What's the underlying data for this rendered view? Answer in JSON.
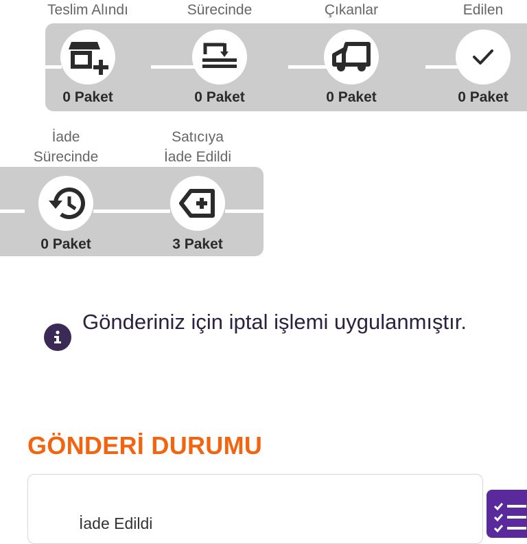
{
  "stages_row1": [
    {
      "label": "Teslim Alındı",
      "count": "0 Paket",
      "icon": "store-add-icon"
    },
    {
      "label": "Sürecinde",
      "count": "0 Paket",
      "icon": "transfer-icon"
    },
    {
      "label": "Çıkanlar",
      "count": "0 Paket",
      "icon": "truck-icon"
    },
    {
      "label": "Edilen",
      "count": "0 Paket",
      "icon": "check-icon"
    }
  ],
  "stages_row2": [
    {
      "label_line1": "İade",
      "label_line2": "Sürecinde",
      "count": "0 Paket",
      "icon": "history-icon"
    },
    {
      "label_line1": "Satıcıya",
      "label_line2": "İade Edildi",
      "count": "3 Paket",
      "icon": "return-tag-icon"
    }
  ],
  "notice": {
    "text": "Gönderiniz için iptal işlemi uygulanmıştır."
  },
  "shipment_status": {
    "title": "GÖNDERİ DURUMU",
    "first_item": "İade Edildi"
  },
  "colors": {
    "accent": "#f2640f",
    "primary": "#5a2a9c",
    "track": "#cccccc",
    "dark": "#3b2a55"
  }
}
